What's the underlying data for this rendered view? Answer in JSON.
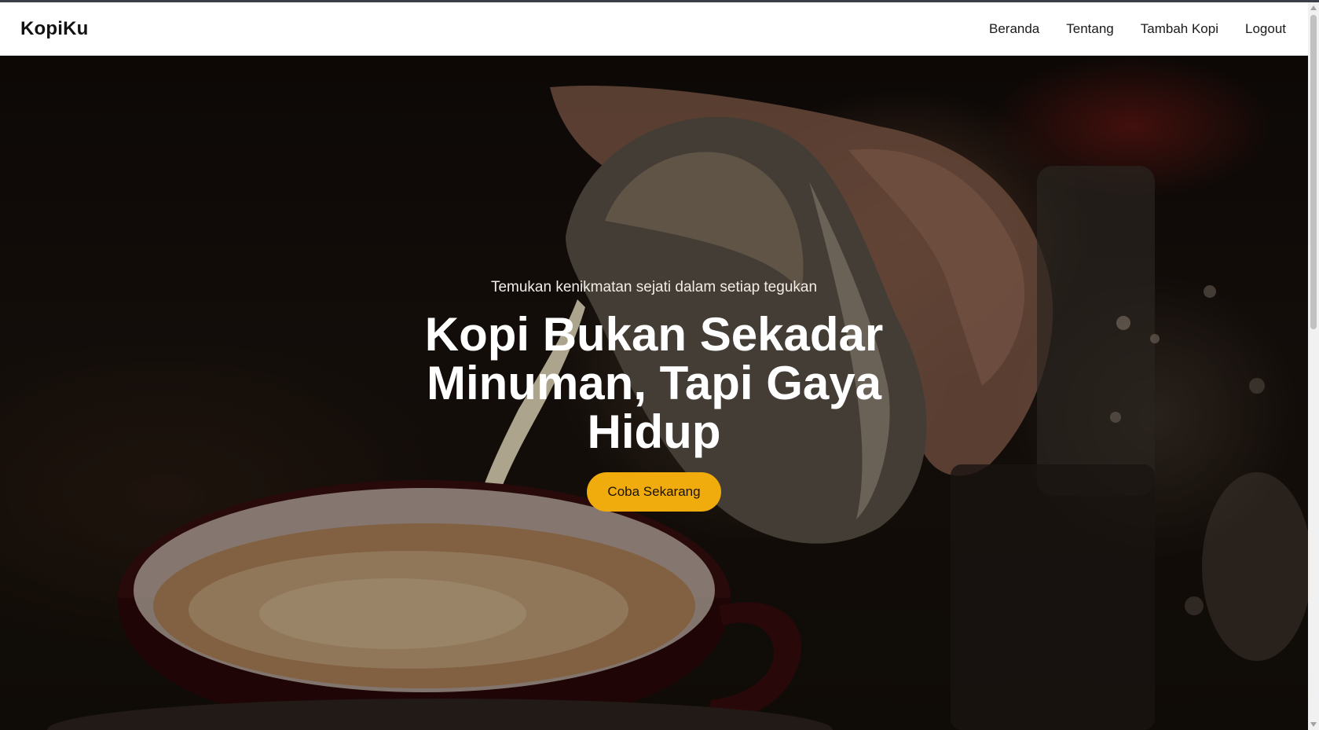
{
  "navbar": {
    "brand": "KopiKu",
    "links": [
      "Beranda",
      "Tentang",
      "Tambah Kopi",
      "Logout"
    ]
  },
  "hero": {
    "tagline": "Temukan kenikmatan sejati dalam setiap tegukan",
    "headline": "Kopi Bukan Sekadar Minuman, Tapi Gaya Hidup",
    "cta_label": "Coba Sekarang",
    "background_image": "latte-pouring-photo"
  },
  "colors": {
    "accent": "#f0ab0c",
    "navbar_bg": "#ffffff",
    "headline": "#ffffff"
  }
}
